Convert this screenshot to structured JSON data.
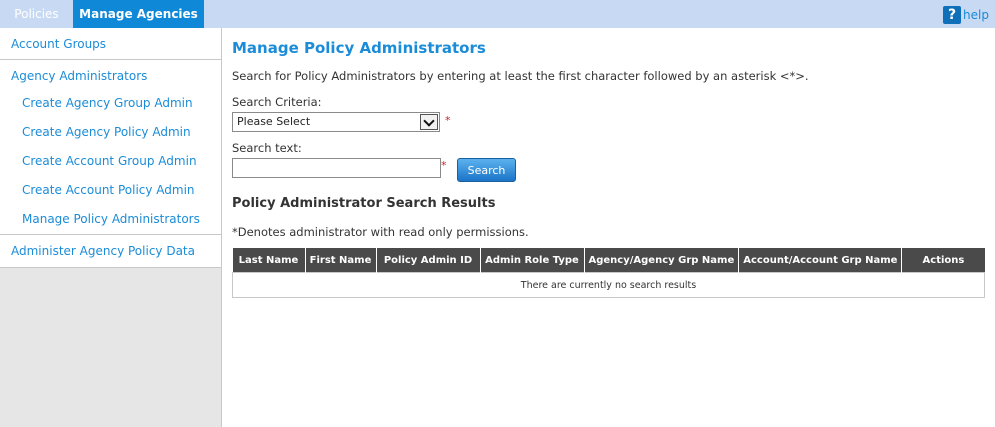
{
  "tabs": [
    {
      "label": "Policies"
    },
    {
      "label": "Manage Agencies"
    }
  ],
  "help": {
    "icon": "?",
    "label": "help"
  },
  "sidebar": {
    "account_groups": "Account Groups",
    "agency_admins": "Agency Administrators",
    "sub_items": [
      "Create Agency Group Admin",
      "Create Agency Policy Admin",
      "Create Account Group Admin",
      "Create Account Policy Admin",
      "Manage Policy Administrators"
    ],
    "administer": "Administer Agency Policy Data"
  },
  "main": {
    "title": "Manage Policy Administrators",
    "instructions": "Search for Policy Administrators by entering at least the first character followed by an asterisk <*>.",
    "criteria_label": "Search Criteria:",
    "criteria_value": "Please Select",
    "required_mark": "*",
    "text_label": "Search text:",
    "text_value": "",
    "search_button": "Search",
    "results_title": "Policy Administrator Search Results",
    "note": "*Denotes administrator with read only permissions.",
    "table": {
      "headers": [
        "Last Name",
        "First Name",
        "Policy Admin ID",
        "Admin Role Type",
        "Agency/Agency Grp Name",
        "Account/Account Grp Name",
        "Actions"
      ],
      "empty_message": "There are currently no search results"
    }
  },
  "colors": {
    "accent": "#1b8cd8",
    "topbar": "#c8daf3",
    "active_tab": "#0f88d8",
    "table_header": "#4a4a4a",
    "required": "#d02020"
  }
}
